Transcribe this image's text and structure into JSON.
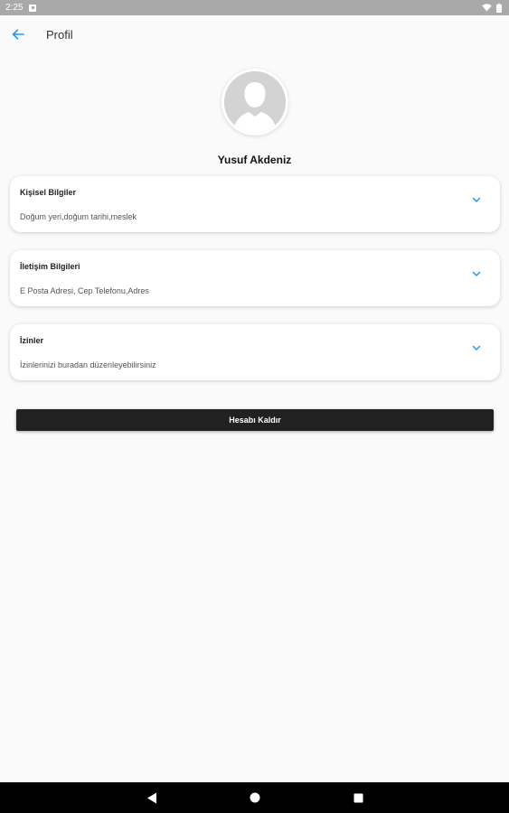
{
  "status_bar": {
    "time": "2:25",
    "icons": [
      "notification-icon",
      "wifi-icon",
      "battery-icon"
    ]
  },
  "app_bar": {
    "title": "Profil",
    "back_icon": "arrow-left-icon"
  },
  "profile": {
    "avatar_icon": "person-silhouette-icon",
    "name": "Yusuf Akdeniz"
  },
  "cards": [
    {
      "title": "Kişisel Bilgiler",
      "subtitle": "Doğum yeri,doğum tarihi,meslek",
      "icon": "chevron-down-icon"
    },
    {
      "title": "İletişim Bilgileri",
      "subtitle": "E Posta Adresi, Cep Telefonu,Adres",
      "icon": "chevron-down-icon"
    },
    {
      "title": "İzinler",
      "subtitle": "İzinlerinizi buradan düzenleyebilirsiniz",
      "icon": "chevron-down-icon"
    }
  ],
  "actions": {
    "remove_account_label": "Hesabı Kaldır"
  },
  "nav_bar": {
    "icons": [
      "back-triangle-icon",
      "home-circle-icon",
      "recents-square-icon"
    ]
  },
  "colors": {
    "accent": "#2196f3",
    "button_bg": "#212121",
    "status_bar_bg": "#a9a9a9",
    "background": "#fafafa"
  }
}
